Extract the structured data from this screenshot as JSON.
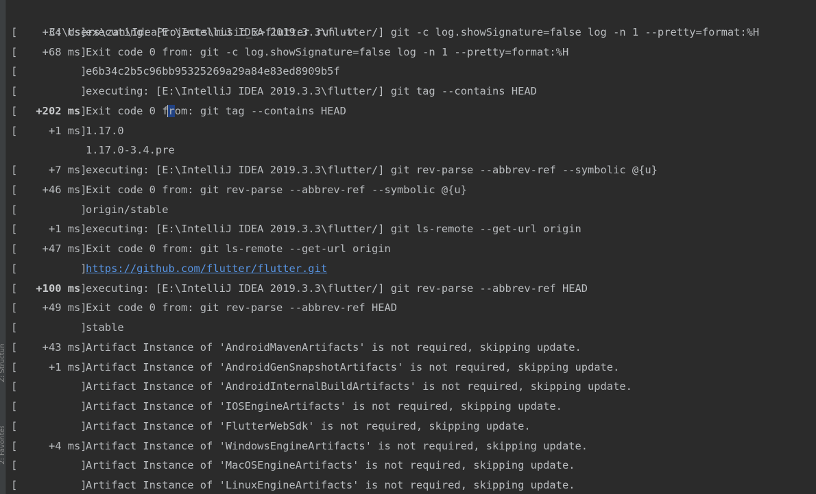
{
  "window": {
    "side_tabs": [
      "Z: Structure",
      "2: Favorites"
    ]
  },
  "terminal": {
    "prompt": "C:\\Users\\zan\\IdeaProjects\\music_x>flutter run -v",
    "lines": [
      {
        "open": "[",
        "ms": "+34 ms",
        "bold": false,
        "close": "]",
        "text": "executing: [E:\\IntelliJ IDEA 2019.3.3\\flutter/] git -c log.showSignature=false log -n 1 --pretty=format:%H"
      },
      {
        "open": "[",
        "ms": "+68 ms",
        "bold": false,
        "close": "]",
        "text": "Exit code 0 from: git -c log.showSignature=false log -n 1 --pretty=format:%H"
      },
      {
        "open": "[",
        "ms": "",
        "bold": false,
        "close": "]",
        "text": "e6b34c2b5c96bb95325269a29a84e83ed8909b5f"
      },
      {
        "open": "[",
        "ms": "",
        "bold": false,
        "close": "]",
        "text": "executing: [E:\\IntelliJ IDEA 2019.3.3\\flutter/] git tag --contains HEAD"
      },
      {
        "open": "[",
        "ms": "+202 ms",
        "bold": true,
        "close": "]",
        "text": "Exit code 0 from: git tag --contains HEAD",
        "highlight": "r"
      },
      {
        "open": "[",
        "ms": "+1 ms",
        "bold": false,
        "close": "]",
        "text": "1.17.0"
      },
      {
        "open": "",
        "ms": "",
        "bold": false,
        "close": "",
        "text": "1.17.0-3.4.pre"
      },
      {
        "open": "[",
        "ms": "+7 ms",
        "bold": false,
        "close": "]",
        "text": "executing: [E:\\IntelliJ IDEA 2019.3.3\\flutter/] git rev-parse --abbrev-ref --symbolic @{u}"
      },
      {
        "open": "[",
        "ms": "+46 ms",
        "bold": false,
        "close": "]",
        "text": "Exit code 0 from: git rev-parse --abbrev-ref --symbolic @{u}"
      },
      {
        "open": "[",
        "ms": "",
        "bold": false,
        "close": "]",
        "text": "origin/stable"
      },
      {
        "open": "[",
        "ms": "+1 ms",
        "bold": false,
        "close": "]",
        "text": "executing: [E:\\IntelliJ IDEA 2019.3.3\\flutter/] git ls-remote --get-url origin"
      },
      {
        "open": "[",
        "ms": "+47 ms",
        "bold": false,
        "close": "]",
        "text": "Exit code 0 from: git ls-remote --get-url origin"
      },
      {
        "open": "[",
        "ms": "",
        "bold": false,
        "close": "]",
        "text": "https://github.com/flutter/flutter.git",
        "link": true
      },
      {
        "open": "[",
        "ms": "+100 ms",
        "bold": true,
        "close": "]",
        "text": "executing: [E:\\IntelliJ IDEA 2019.3.3\\flutter/] git rev-parse --abbrev-ref HEAD"
      },
      {
        "open": "[",
        "ms": "+49 ms",
        "bold": false,
        "close": "]",
        "text": "Exit code 0 from: git rev-parse --abbrev-ref HEAD"
      },
      {
        "open": "[",
        "ms": "",
        "bold": false,
        "close": "]",
        "text": "stable"
      },
      {
        "open": "[",
        "ms": "+43 ms",
        "bold": false,
        "close": "]",
        "text": "Artifact Instance of 'AndroidMavenArtifacts' is not required, skipping update."
      },
      {
        "open": "[",
        "ms": "+1 ms",
        "bold": false,
        "close": "]",
        "text": "Artifact Instance of 'AndroidGenSnapshotArtifacts' is not required, skipping update."
      },
      {
        "open": "[",
        "ms": "",
        "bold": false,
        "close": "]",
        "text": "Artifact Instance of 'AndroidInternalBuildArtifacts' is not required, skipping update."
      },
      {
        "open": "[",
        "ms": "",
        "bold": false,
        "close": "]",
        "text": "Artifact Instance of 'IOSEngineArtifacts' is not required, skipping update."
      },
      {
        "open": "[",
        "ms": "",
        "bold": false,
        "close": "]",
        "text": "Artifact Instance of 'FlutterWebSdk' is not required, skipping update."
      },
      {
        "open": "[",
        "ms": "+4 ms",
        "bold": false,
        "close": "]",
        "text": "Artifact Instance of 'WindowsEngineArtifacts' is not required, skipping update."
      },
      {
        "open": "[",
        "ms": "",
        "bold": false,
        "close": "]",
        "text": "Artifact Instance of 'MacOSEngineArtifacts' is not required, skipping update."
      },
      {
        "open": "[",
        "ms": "",
        "bold": false,
        "close": "]",
        "text": "Artifact Instance of 'LinuxEngineArtifacts' is not required, skipping update."
      }
    ]
  }
}
